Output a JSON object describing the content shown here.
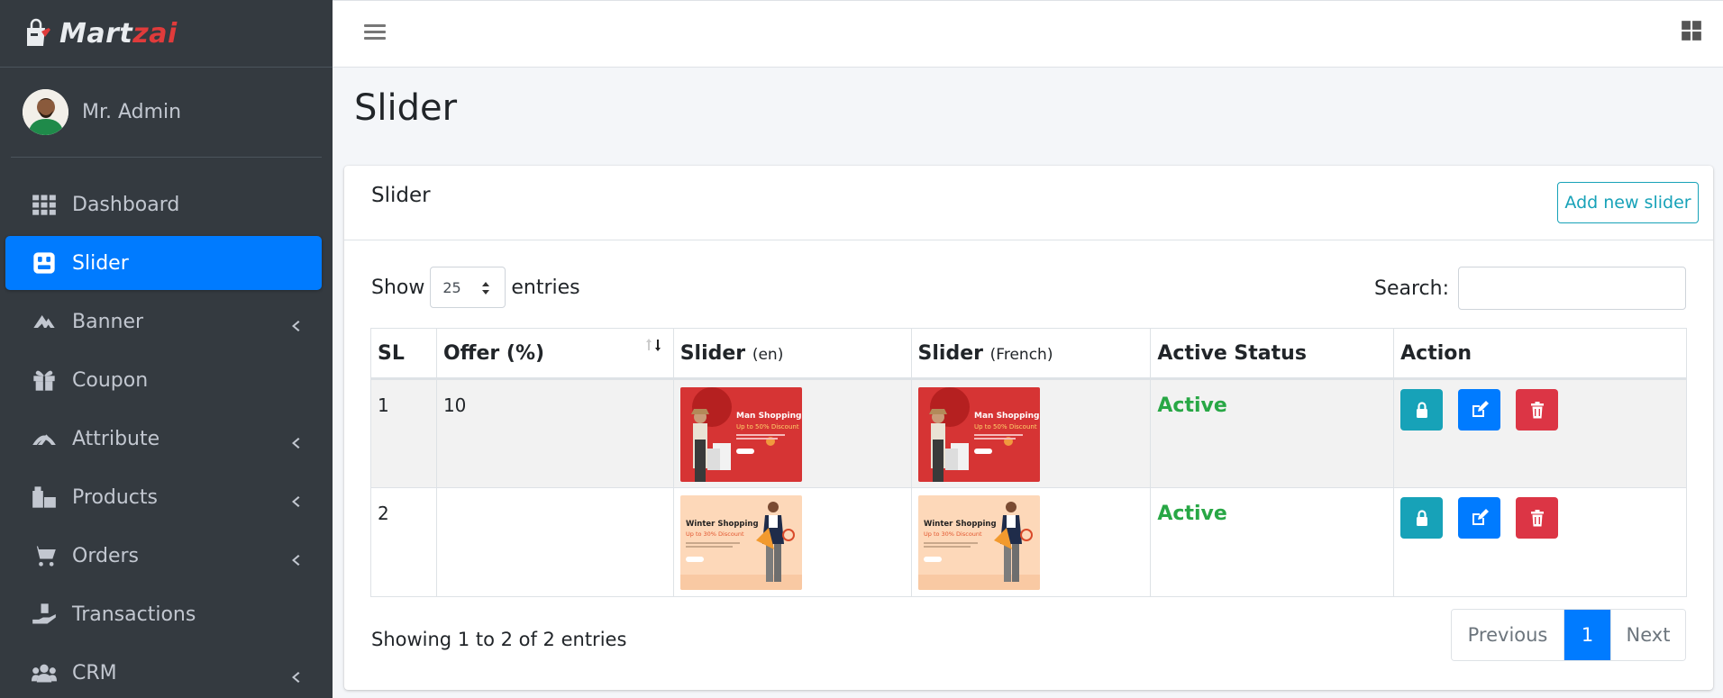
{
  "brand": {
    "part1": "Mart",
    "part2": "zai"
  },
  "user": {
    "name": "Mr. Admin"
  },
  "sidebar": {
    "items": [
      {
        "label": "Dashboard",
        "icon": "dashboard-icon",
        "has_arrow": false,
        "active": false
      },
      {
        "label": "Slider",
        "icon": "slider-icon",
        "has_arrow": false,
        "active": true
      },
      {
        "label": "Banner",
        "icon": "banner-icon",
        "has_arrow": true,
        "active": false
      },
      {
        "label": "Coupon",
        "icon": "gift-icon",
        "has_arrow": false,
        "active": false
      },
      {
        "label": "Attribute",
        "icon": "attribute-icon",
        "has_arrow": true,
        "active": false
      },
      {
        "label": "Products",
        "icon": "products-icon",
        "has_arrow": true,
        "active": false
      },
      {
        "label": "Orders",
        "icon": "cart-icon",
        "has_arrow": true,
        "active": false
      },
      {
        "label": "Transactions",
        "icon": "transactions-icon",
        "has_arrow": false,
        "active": false
      },
      {
        "label": "CRM",
        "icon": "users-icon",
        "has_arrow": true,
        "active": false
      }
    ]
  },
  "page": {
    "title": "Slider"
  },
  "card": {
    "title": "Slider",
    "add_button": "Add new slider"
  },
  "table_controls": {
    "show_label": "Show",
    "entries_label": "entries",
    "page_length": "25",
    "search_label": "Search:"
  },
  "table": {
    "headers": {
      "sl": "SL",
      "offer": "Offer (%)",
      "slider_en": "Slider",
      "slider_en_sub": "(en)",
      "slider_fr": "Slider",
      "slider_fr_sub": "(French)",
      "status": "Active Status",
      "action": "Action"
    },
    "rows": [
      {
        "sl": "1",
        "offer": "10",
        "status": "Active",
        "image": {
          "title": "Man Shopping",
          "subtitle": "Up to 50% Discount",
          "bg": "#d63434"
        }
      },
      {
        "sl": "2",
        "offer": "",
        "status": "Active",
        "image": {
          "title": "Winter Shopping",
          "subtitle": "Up to 30% Discount",
          "bg": "#fdd8b9"
        }
      }
    ]
  },
  "footer": {
    "info": "Showing 1 to 2 of 2 entries",
    "prev": "Previous",
    "current": "1",
    "next": "Next"
  },
  "colors": {
    "sidebar_bg": "#343a40",
    "active_nav": "#007bff",
    "status_green": "#28a745",
    "info": "#17a2b8",
    "danger": "#dc3545"
  }
}
